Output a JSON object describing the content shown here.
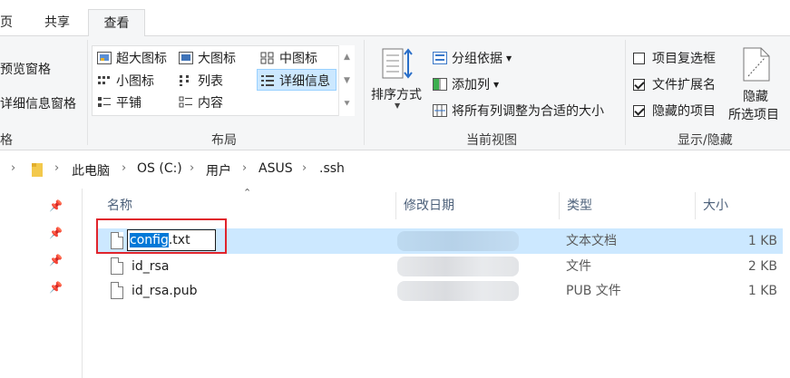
{
  "tabs": [
    "页",
    "共享",
    "查看"
  ],
  "ribbon": {
    "pane_group": {
      "items": [
        "预览窗格",
        "详细信息窗格"
      ],
      "label": "格"
    },
    "layout_group": {
      "items": [
        "超大图标",
        "大图标",
        "中图标",
        "小图标",
        "列表",
        "详细信息",
        "平铺",
        "内容"
      ],
      "selected": "详细信息",
      "label": "布局"
    },
    "current_view_group": {
      "sort_label": "排序方式",
      "group_by": "分组依据",
      "add_column": "添加列",
      "resize_columns": "将所有列调整为合适的大小",
      "label": "当前视图"
    },
    "show_hide_group": {
      "checkboxes": [
        {
          "label": "项目复选框",
          "checked": false
        },
        {
          "label": "文件扩展名",
          "checked": true
        },
        {
          "label": "隐藏的项目",
          "checked": true
        }
      ],
      "hide_selected_line1": "隐藏",
      "hide_selected_line2": "所选项目",
      "label": "显示/隐藏"
    }
  },
  "address": {
    "crumbs": [
      "此电脑",
      "OS (C:)",
      "用户",
      "ASUS",
      ".ssh"
    ]
  },
  "columns": {
    "name": "名称",
    "date": "修改日期",
    "type": "类型",
    "size": "大小"
  },
  "files": [
    {
      "name": "config.txt",
      "type": "文本文档",
      "size": "1 KB",
      "selected": true
    },
    {
      "name": "id_rsa",
      "type": "文件",
      "size": "2 KB",
      "selected": false
    },
    {
      "name": "id_rsa.pub",
      "type": "PUB 文件",
      "size": "1 KB",
      "selected": false
    }
  ],
  "rename": {
    "selected_part": "config",
    "rest": ".txt"
  },
  "colors": {
    "selection": "#cce8ff",
    "highlight": "#0078d7",
    "annotation_box": "#e0242c"
  }
}
